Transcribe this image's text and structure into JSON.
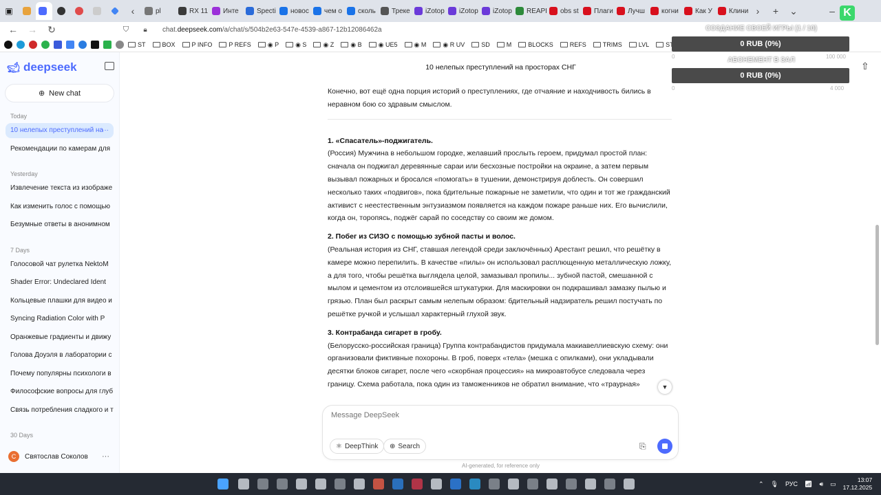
{
  "browser": {
    "tabs": [
      {
        "label": "pl",
        "color": "#777"
      },
      {
        "label": "RX 11",
        "color": "#3a3a3a"
      },
      {
        "label": "Инте",
        "color": "#9b30d9"
      },
      {
        "label": "Specti",
        "color": "#2a6bd9"
      },
      {
        "label": "новос",
        "color": "#1a73e8"
      },
      {
        "label": "чем о",
        "color": "#1a73e8"
      },
      {
        "label": "сколь",
        "color": "#1a73e8"
      },
      {
        "label": "Треке",
        "color": "#555"
      },
      {
        "label": "iZotop",
        "color": "#6b3ad9"
      },
      {
        "label": "iZotop",
        "color": "#6b3ad9"
      },
      {
        "label": "iZotop",
        "color": "#6b3ad9"
      },
      {
        "label": "REAPE",
        "color": "#2d8a3a"
      },
      {
        "label": "obs st",
        "color": "#d8101d"
      },
      {
        "label": "Плаги",
        "color": "#d8101d"
      },
      {
        "label": "Лучш",
        "color": "#d8101d"
      },
      {
        "label": "когни",
        "color": "#d8101d"
      },
      {
        "label": "Как У",
        "color": "#d8101d"
      },
      {
        "label": "Клини",
        "color": "#d8101d"
      }
    ],
    "url_prefix": "chat.",
    "url_domain": "deepseek.com",
    "url_path": "/a/chat/s/504b2e63-547e-4539-a867-12b12086462a",
    "bookmarks": [
      "ST",
      "BOX",
      "P INFO",
      "P REFS",
      "◉ P",
      "◉ S",
      "◉ Z",
      "◉ B",
      "◉ UE5",
      "◉ M",
      "◉ R UV",
      "SD",
      "M",
      "BLOCKS",
      "REFS",
      "TRIMS",
      "LVL",
      "ST"
    ]
  },
  "sidebar": {
    "logo_text": "deepseek",
    "new_chat_label": "New chat",
    "groups": [
      {
        "label": "Today",
        "items": [
          "10 нелепых преступлений на",
          "Рекомендации по камерам для"
        ]
      },
      {
        "label": "Yesterday",
        "items": [
          "Извлечение текста из изображе",
          "Как изменить голос с помощью",
          "Безумные ответы в анонимном"
        ]
      },
      {
        "label": "7 Days",
        "items": [
          "Голосовой чат рулетка NektoM",
          "Shader Error: Undeclared Ident",
          "Кольцевые плашки для видео и",
          "Syncing Radiation Color with P",
          "Оранжевые градиенты и движу",
          "Голова Доуэля в лаборатории с",
          "Почему популярны психологи в",
          "Философские вопросы для глуб",
          "Связь потребления сладкого и т"
        ]
      },
      {
        "label": "30 Days",
        "items": []
      }
    ],
    "user": {
      "initial": "С",
      "name": "Святослав Соколов"
    }
  },
  "chat": {
    "title": "10 нелепых преступлений на просторах СНГ",
    "intro": "Конечно, вот ещё одна порция историй о преступлениях, где отчаяние и находчивость бились в неравном бою со здравым смыслом.",
    "items": [
      {
        "title": "1. «Спасатель»-поджигатель.",
        "text": "(Россия) Мужчина в небольшом городке, желавший прослыть героем, придумал простой план: сначала он поджигал деревянные сараи или бесхозные постройки на окраине, а затем первым вызывал пожарных и бросался «помогать» в тушении, демонстрируя доблесть. Он совершил несколько таких «подвигов», пока бдительные пожарные не заметили, что один и тот же гражданский активист с неестественным энтузиазмом появляется на каждом пожаре раньше них. Его вычислили, когда он, торопясь, поджёг сарай по соседству со своим же домом."
      },
      {
        "title": "2. Побег из СИЗО с помощью зубной пасты и волос.",
        "text": "(Реальная история из СНГ, ставшая легендой среди заключённых) Арестант решил, что решётку в камере можно перепилить. В качестве «пилы» он использовал расплющенную металлическую ложку, а для того, чтобы решётка выглядела целой, замазывал пропилы... зубной пастой, смешанной с мылом и цементом из отслоившейся штукатурки. Для маскировки он подкрашивал замазку пылью и грязью. План был раскрыт самым нелепым образом: бдительный надзиратель решил постучать по решётке ручкой и услышал характерный глухой звук."
      },
      {
        "title": "3. Контрабанда сигарет в гробу.",
        "text": "(Белорусско-российская граница) Группа контрабандистов придумала макиавеллиевскую схему: они организовали фиктивные похороны. В гроб, поверх «тела» (мешка с опилками), они укладывали десятки блоков сигарет, после чего «скорбная процессия» на микроавтобусе следовала через границу. Схема работала, пока один из таможенников не обратил внимание, что «траурная»"
      }
    ],
    "composer_placeholder": "Message DeepSeek",
    "deepthink_label": "DeepThink",
    "search_label": "Search",
    "disclaimer": "AI-generated, for reference only"
  },
  "overlay": {
    "title1": "СОЗДАНИЕ СВОЕЙ ИГРЫ (1 / 10)",
    "bar1": "0 RUB (0%)",
    "title2": "АБОНЕМЕНТ В ЗАЛ",
    "bar2": "0 RUB (0%)",
    "small1_left": "0",
    "small1_right": "100 000",
    "small2_left": "0",
    "small2_right": "4 000"
  },
  "taskbar": {
    "language": "РУС",
    "time": "13:07",
    "date": "17.12.2025",
    "icons": [
      "#4aa3ff",
      "#cfd3da",
      "#8a8f98",
      "#8a8f98",
      "#cfd3da",
      "#cfd3da",
      "#8a8f98",
      "#cfd3da",
      "#e05a47",
      "#2b7bd3",
      "#c9364b",
      "#cfd3da",
      "#2d7ee0",
      "#2b9bd9",
      "#8a8f98",
      "#cfd3da",
      "#8a8f98",
      "#cfd3da",
      "#8a8f98",
      "#cfd3da",
      "#8a8f98",
      "#cfd3da"
    ]
  }
}
